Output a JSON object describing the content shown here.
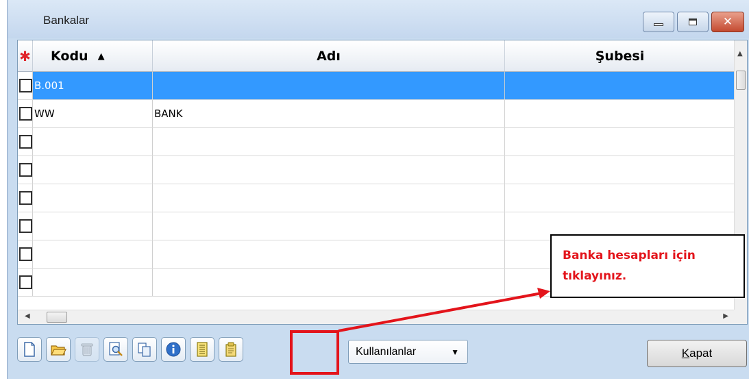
{
  "window": {
    "title": "Bankalar",
    "controls": [
      "minimize",
      "maximize",
      "close"
    ]
  },
  "grid": {
    "columns": [
      {
        "label": "Kodu",
        "sort": "ascending"
      },
      {
        "label": "Adı"
      },
      {
        "label": "Şubesi"
      }
    ],
    "rows": [
      {
        "kodu": "B.001",
        "adi": "",
        "subesi": "",
        "selected": true
      },
      {
        "kodu": "WW",
        "adi": "BANK",
        "subesi": "",
        "selected": false
      },
      {
        "kodu": "",
        "adi": "",
        "subesi": ""
      },
      {
        "kodu": "",
        "adi": "",
        "subesi": ""
      },
      {
        "kodu": "",
        "adi": "",
        "subesi": ""
      },
      {
        "kodu": "",
        "adi": "",
        "subesi": ""
      },
      {
        "kodu": "",
        "adi": "",
        "subesi": ""
      },
      {
        "kodu": "",
        "adi": "",
        "subesi": ""
      }
    ]
  },
  "toolbar": {
    "buttons": [
      "new-document-icon",
      "open-folder-icon",
      "trash-icon",
      "search-icon",
      "copy-icon",
      "info-icon",
      "notes-icon",
      "bank-accounts-icon"
    ],
    "filter_value": "Kullanılanlar",
    "close_label_prefix": "K",
    "close_label_rest": "apat"
  },
  "annotation": {
    "line1": "Banka hesapları için",
    "line2": "tıklayınız.",
    "color": "#e3141b"
  },
  "colors": {
    "selection": "#3399ff",
    "window_bg": "#c9dcf0"
  }
}
